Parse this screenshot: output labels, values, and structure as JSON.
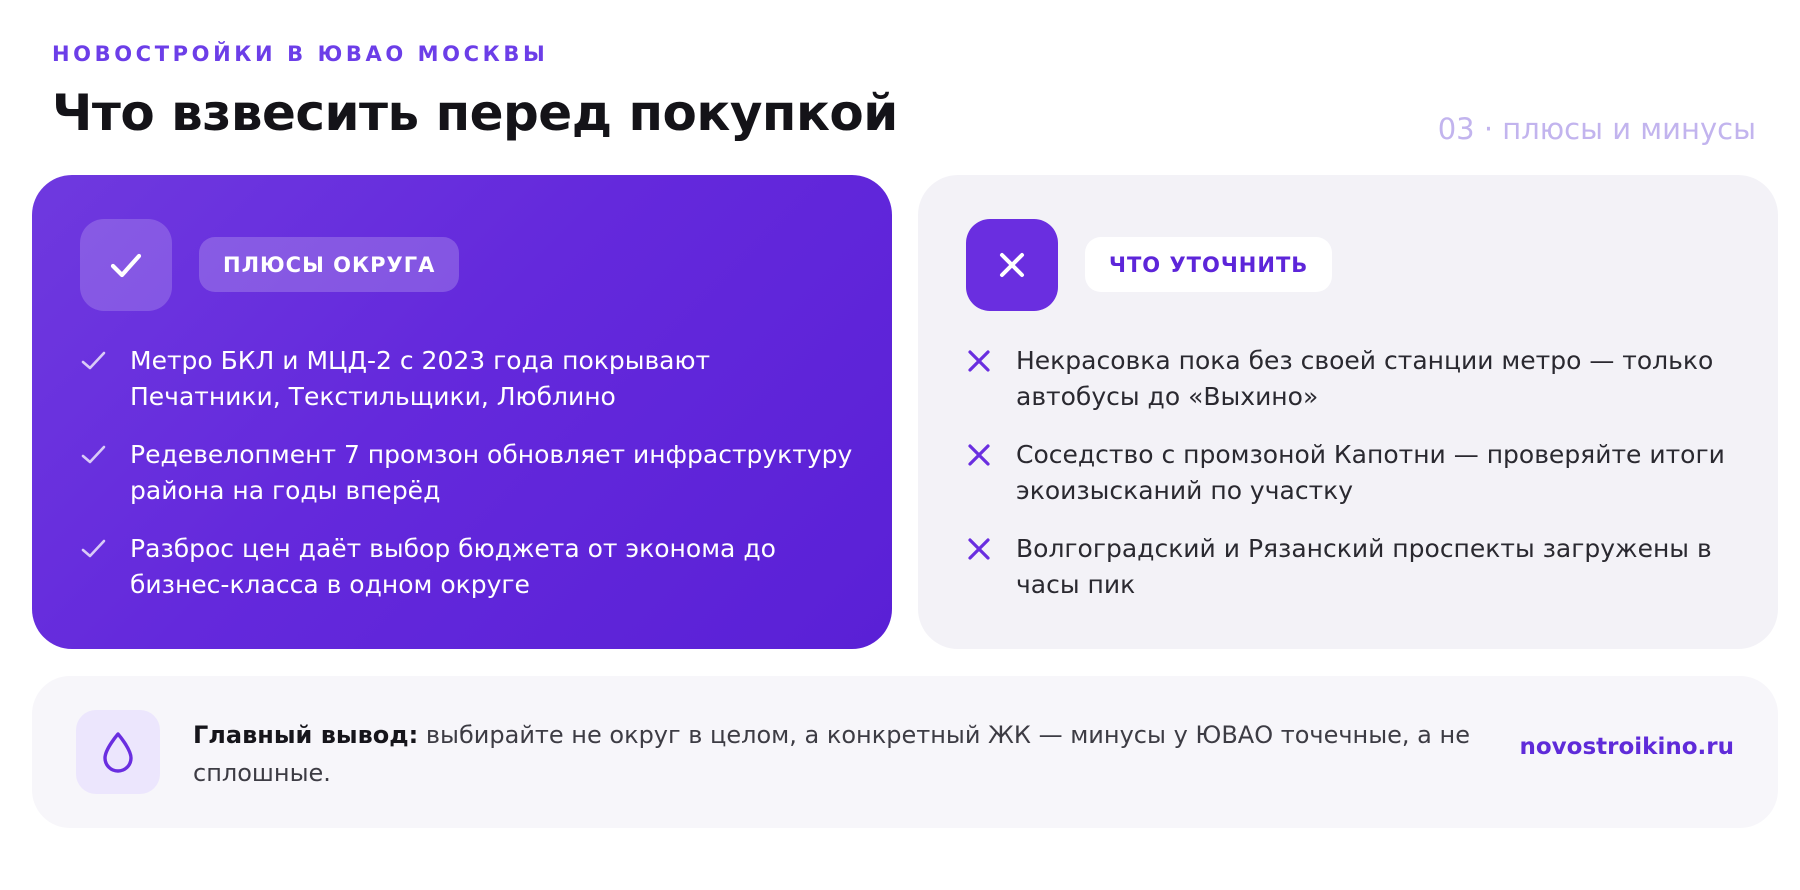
{
  "header": {
    "eyebrow": "НОВОСТРОЙКИ В ЮВАО МОСКВЫ",
    "title": "Что взвесить перед покупкой",
    "slide_counter": "03 · плюсы и минусы"
  },
  "pros": {
    "label": "ПЛЮСЫ ОКРУГА",
    "icon": "check-icon",
    "items": [
      {
        "text": "Метро БКЛ и МЦД-2 с 2023 года покрывают Печатники, Текстильщики, Люблино"
      },
      {
        "text": "Редевелопмент 7 промзон обновляет инфраструктуру района на годы вперёд"
      },
      {
        "text": "Разброс цен даёт выбор бюджета от эконома до бизнес-класса в одном округе"
      }
    ]
  },
  "cons": {
    "label": "ЧТО УТОЧНИТЬ",
    "icon": "close-icon",
    "items": [
      {
        "text": "Некрасовка пока без своей станции метро — только автобусы до «Выхино»"
      },
      {
        "text": "Соседство с промзоной Капотни — проверяйте итоги экоизысканий по участку"
      },
      {
        "text": "Волгоградский и Рязанский проспекты загружены в часы пик"
      }
    ]
  },
  "summary": {
    "icon": "drop-icon",
    "lead": "Главный вывод:",
    "text": " выбирайте не округ в целом, а конкретный ЖК — минусы у ЮВАО точечные, а не сплошные.",
    "link": "novostroikino.ru"
  },
  "colors": {
    "accent": "#6c3ee8",
    "pros_card": "#6429dc",
    "cons_card": "#f3f2f7",
    "summary_bg": "#f7f6fa"
  }
}
